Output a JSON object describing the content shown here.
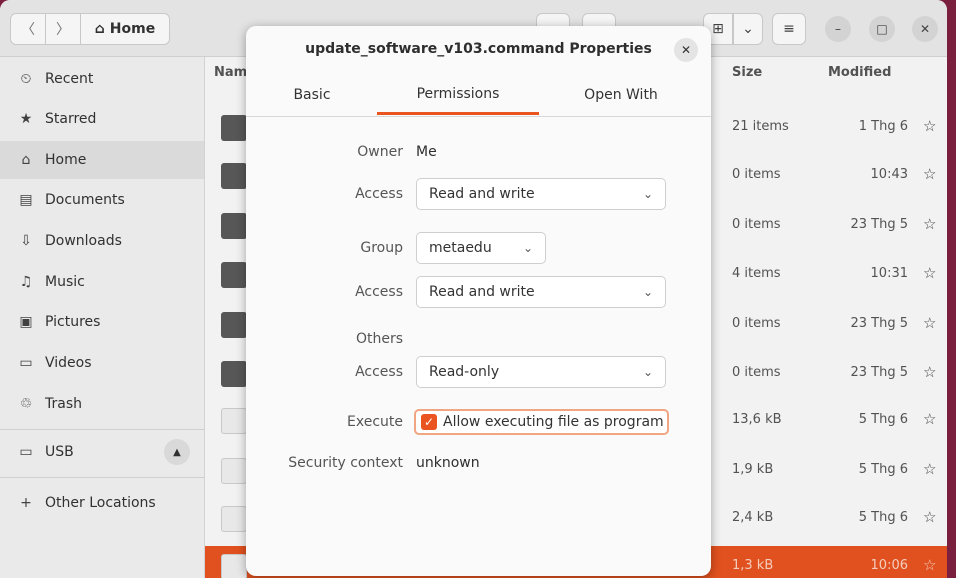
{
  "header": {
    "back_icon": "〈",
    "forward_icon": "〉",
    "location": "Home",
    "view_grid_icon": "⊞",
    "view_chevron": "⌄",
    "menu_icon": "≡",
    "minimize_icon": "–",
    "maximize_icon": "□",
    "close_icon": "✕"
  },
  "sidebar": {
    "items": [
      {
        "label": "Recent",
        "icon": "clock-icon",
        "glyph": "⏲"
      },
      {
        "label": "Starred",
        "icon": "star-icon",
        "glyph": "★"
      },
      {
        "label": "Home",
        "icon": "home-icon",
        "glyph": "⌂"
      },
      {
        "label": "Documents",
        "icon": "document-icon",
        "glyph": "▤"
      },
      {
        "label": "Downloads",
        "icon": "download-icon",
        "glyph": "⇩"
      },
      {
        "label": "Music",
        "icon": "music-icon",
        "glyph": "♫"
      },
      {
        "label": "Pictures",
        "icon": "picture-icon",
        "glyph": "▣"
      },
      {
        "label": "Videos",
        "icon": "video-icon",
        "glyph": "▭"
      },
      {
        "label": "Trash",
        "icon": "trash-icon",
        "glyph": "♲"
      }
    ],
    "usb": {
      "label": "USB",
      "glyph": "▭",
      "eject": "▲"
    },
    "other": {
      "label": "Other Locations",
      "glyph": "+"
    }
  },
  "columns": {
    "name": "Nam",
    "size": "Size",
    "modified": "Modified"
  },
  "files": [
    {
      "size": "21 items",
      "modified": "1 Thg 6"
    },
    {
      "size": "0 items",
      "modified": "10:43"
    },
    {
      "size": "0 items",
      "modified": "23 Thg 5"
    },
    {
      "size": "4 items",
      "modified": "10:31"
    },
    {
      "size": "0 items",
      "modified": "23 Thg 5"
    },
    {
      "size": "0 items",
      "modified": "23 Thg 5"
    },
    {
      "size": "13,6 kB",
      "modified": "5 Thg 6"
    },
    {
      "size": "1,9 kB",
      "modified": "5 Thg 6"
    },
    {
      "size": "2,4 kB",
      "modified": "5 Thg 6"
    },
    {
      "size": "1,3 kB",
      "modified": "10:06"
    }
  ],
  "star_glyph": "☆",
  "dialog": {
    "title": "update_software_v103.command Properties",
    "close": "✕",
    "tabs": [
      "Basic",
      "Permissions",
      "Open With"
    ],
    "active_tab": "Permissions",
    "owner_label": "Owner",
    "owner_value": "Me",
    "owner_access_label": "Access",
    "owner_access_value": "Read and write",
    "group_label": "Group",
    "group_value": "metaedu",
    "group_access_label": "Access",
    "group_access_value": "Read and write",
    "others_label": "Others",
    "others_access_label": "Access",
    "others_access_value": "Read-only",
    "execute_label": "Execute",
    "execute_text": "Allow executing file as program",
    "execute_checked": "✓",
    "security_label": "Security context",
    "security_value": "unknown",
    "chevron": "⌄"
  },
  "colors": {
    "accent": "#e95420",
    "background": "#7a1f3d"
  }
}
